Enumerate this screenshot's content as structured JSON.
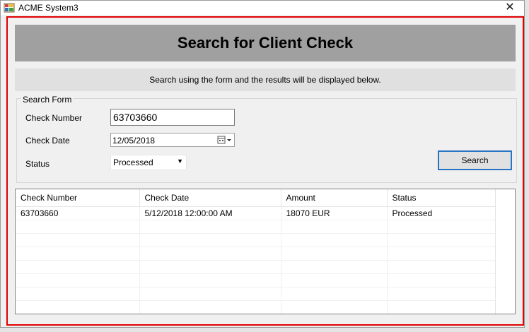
{
  "window": {
    "title": "ACME System3",
    "close_glyph": "✕"
  },
  "header": {
    "title": "Search for Client Check",
    "instructions": "Search using the form and the results will be displayed below."
  },
  "search_form": {
    "legend": "Search Form",
    "check_number_label": "Check Number",
    "check_number_value": "63703660",
    "check_date_label": "Check Date",
    "check_date_value": "12/05/2018",
    "status_label": "Status",
    "status_value": "Processed",
    "search_button": "Search"
  },
  "results": {
    "columns": [
      "Check Number",
      "Check Date",
      "Amount",
      "Status"
    ],
    "rows": [
      [
        "63703660",
        "5/12/2018 12:00:00 AM",
        "18070 EUR",
        "Processed"
      ]
    ]
  },
  "colors": {
    "highlight_border": "#e00000",
    "banner_bg": "#a0a0a0",
    "button_focus": "#2a74c4"
  }
}
